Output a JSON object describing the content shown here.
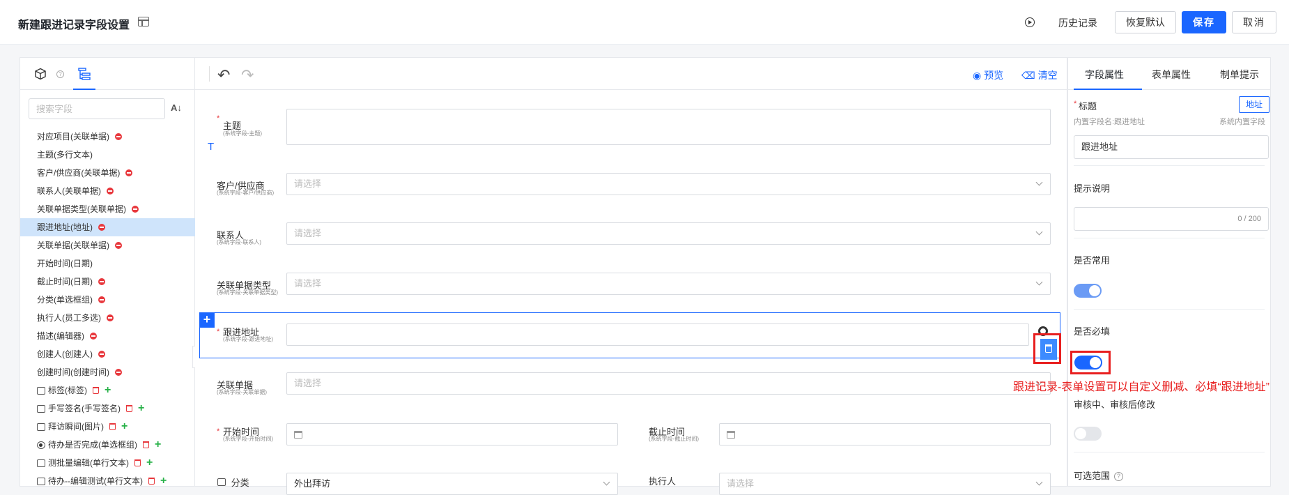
{
  "header": {
    "title": "新建跟进记录字段设置",
    "history": "历史记录",
    "restore": "恢复默认",
    "save": "保存",
    "cancel": "取消"
  },
  "left": {
    "search_placeholder": "搜索字段",
    "sort_icon": "sort-az-icon",
    "fields": [
      {
        "label": "对应项目(关联单据)"
      },
      {
        "label": "主题(多行文本)"
      },
      {
        "label": "客户/供应商(关联单据)"
      },
      {
        "label": "联系人(关联单据)"
      },
      {
        "label": "关联单据类型(关联单据)"
      },
      {
        "label": "跟进地址(地址)"
      },
      {
        "label": "关联单据(关联单据)"
      },
      {
        "label": "开始时间(日期)"
      },
      {
        "label": "截止时间(日期)"
      },
      {
        "label": "分类(单选框组)"
      },
      {
        "label": "执行人(员工多选)"
      },
      {
        "label": "描述(编辑器)"
      },
      {
        "label": "创建人(创建人)"
      },
      {
        "label": "创建时间(创建时间)"
      },
      {
        "label": "标签(标签)"
      },
      {
        "label": "手写签名(手写签名)"
      },
      {
        "label": "拜访瞬间(图片)"
      },
      {
        "label": "待办是否完成(单选框组)"
      },
      {
        "label": "测批量编辑(单行文本)"
      },
      {
        "label": "待办--编辑测试(单行文本)"
      }
    ]
  },
  "center": {
    "preview": "预览",
    "clear": "清空",
    "rows": {
      "subject": {
        "label": "主题",
        "sub": "(系统字段-主题)"
      },
      "customer": {
        "label": "客户/供应商",
        "sub": "(系统字段-客户/供应商)",
        "placeholder": "请选择"
      },
      "contact": {
        "label": "联系人",
        "sub": "(系统字段-联系人)",
        "placeholder": "请选择"
      },
      "doc_type": {
        "label": "关联单据类型",
        "sub": "(系统字段-关联单据类型)",
        "placeholder": "请选择"
      },
      "address": {
        "label": "跟进地址",
        "sub": "(系统字段-跟进地址)"
      },
      "doc": {
        "label": "关联单据",
        "sub": "(系统字段-关联单据)",
        "placeholder": "请选择"
      },
      "start": {
        "label": "开始时间",
        "sub": "(系统字段-开始时间)"
      },
      "end": {
        "label": "截止时间",
        "sub": "(系统字段-截止时间)"
      },
      "category": {
        "label": "分类",
        "value": "外出拜访"
      },
      "executor": {
        "label": "执行人",
        "placeholder": "请选择"
      }
    }
  },
  "right": {
    "tabs": [
      "字段属性",
      "表单属性",
      "制单提示"
    ],
    "title_label": "标题",
    "title_tag": "地址",
    "builtin_name": "内置字段名:跟进地址",
    "builtin_type": "系统内置字段",
    "title_value": "跟进地址",
    "hint_label": "提示说明",
    "hint_counter": "0 / 200",
    "common_label": "是否常用",
    "required_label": "是否必填",
    "audit_label": "审核中、审核后修改",
    "range_label": "可选范围"
  },
  "annotation": "跟进记录-表单设置可以自定义删减、必填“跟进地址”",
  "colors": {
    "primary": "#1a66ff",
    "selected_bg": "#cfe4fb",
    "annotation": "#e81f1f",
    "delete": "#e8383d",
    "add": "#27b148"
  }
}
